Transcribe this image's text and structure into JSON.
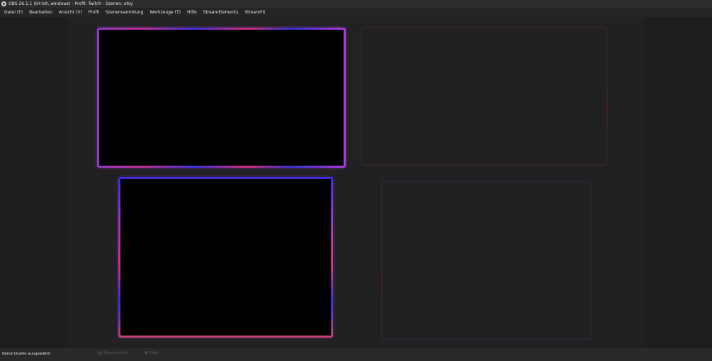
{
  "window": {
    "title": "OBS 26.1.1 (64-bit, windows) - Profil: Twitch - Szenen: etsy"
  },
  "menu": {
    "items": [
      "Datei (F)",
      "Bearbeiten",
      "Ansicht (V)",
      "Profil",
      "Szenensammlung",
      "Werkzeuge (T)",
      "Hilfe",
      "StreamElements",
      "StreamFX"
    ]
  },
  "status": {
    "no_source": "Keine Quelle ausgewählt",
    "properties_label": "Eigenschaften",
    "filters_label": "Filter"
  },
  "colors": {
    "background": "#1f1e1f",
    "titlebar": "#2e2d2e",
    "frame_purple": "#8b3ac9",
    "frame_blue": "#3a2bdc",
    "frame_pink": "#d43080"
  },
  "icons": {
    "app": "obs-logo-icon",
    "properties": "gear-icon",
    "filters": "filter-icon"
  }
}
